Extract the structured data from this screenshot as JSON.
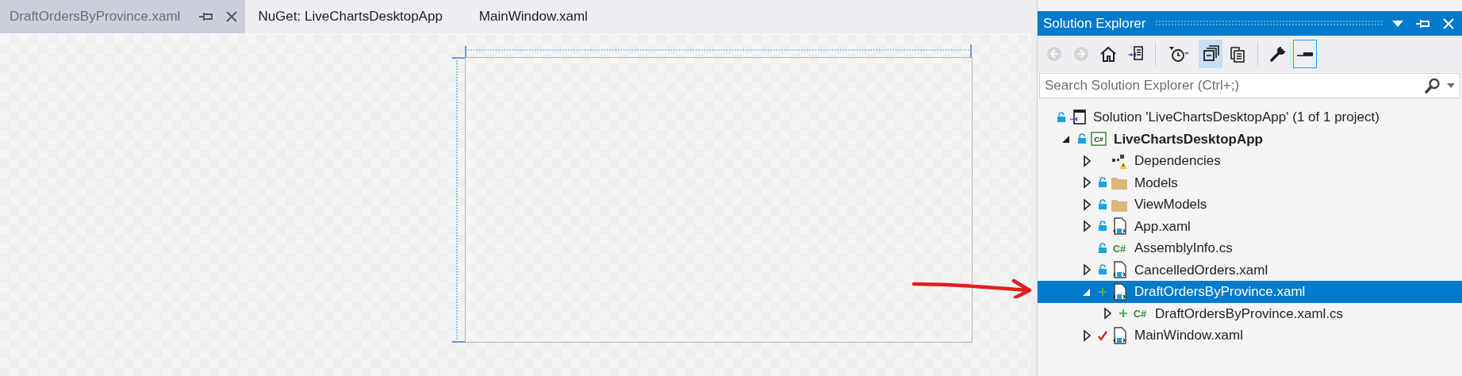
{
  "tabs": [
    {
      "label": "DraftOrdersByProvince.xaml",
      "selected": true
    },
    {
      "label": "NuGet: LiveChartsDesktopApp",
      "selected": false
    },
    {
      "label": "MainWindow.xaml",
      "selected": false
    }
  ],
  "solution_explorer": {
    "title": "Solution Explorer",
    "toolbar": [
      {
        "kind": "back",
        "disabled": true,
        "selected": false
      },
      {
        "kind": "forward",
        "disabled": true,
        "selected": false
      },
      {
        "kind": "home",
        "disabled": false,
        "selected": false
      },
      {
        "kind": "switch-views",
        "disabled": false,
        "selected": false
      },
      {
        "kind": "separator"
      },
      {
        "kind": "pending-filter",
        "disabled": false,
        "selected": false
      },
      {
        "kind": "collapse-all",
        "disabled": false,
        "selected": true
      },
      {
        "kind": "show-all",
        "disabled": false,
        "selected": false
      },
      {
        "kind": "separator"
      },
      {
        "kind": "properties",
        "disabled": false,
        "selected": false
      },
      {
        "kind": "preview",
        "disabled": false,
        "selected": true
      }
    ],
    "search": {
      "placeholder": "Search Solution Explorer (Ctrl+;)"
    },
    "tree": [
      {
        "label": "Solution 'LiveChartsDesktopApp' (1 of 1 project)",
        "kind": "solution",
        "locked": true,
        "added": false,
        "checked_in": false,
        "selected": false,
        "children": [
          {
            "label": "LiveChartsDesktopApp",
            "kind": "project",
            "icon_label": "C#",
            "expanded": true,
            "locked": true,
            "added": false,
            "checked_in": false,
            "selected": false,
            "children": [
              {
                "label": "Dependencies",
                "kind": "dependencies",
                "expanded": false,
                "locked": false,
                "added": false,
                "checked_in": false,
                "selected": false
              },
              {
                "label": "Models",
                "kind": "folder",
                "expanded": false,
                "locked": true,
                "added": false,
                "checked_in": false,
                "selected": false
              },
              {
                "label": "ViewModels",
                "kind": "folder",
                "expanded": false,
                "locked": true,
                "added": false,
                "checked_in": false,
                "selected": false
              },
              {
                "label": "App.xaml",
                "kind": "xaml",
                "expanded": false,
                "locked": true,
                "added": false,
                "checked_in": false,
                "selected": false
              },
              {
                "label": "AssemblyInfo.cs",
                "kind": "cs",
                "icon_label": "C#",
                "locked": true,
                "added": false,
                "checked_in": false,
                "selected": false
              },
              {
                "label": "CancelledOrders.xaml",
                "kind": "xaml",
                "expanded": false,
                "locked": true,
                "added": false,
                "checked_in": false,
                "selected": false
              },
              {
                "label": "DraftOrdersByProvince.xaml",
                "kind": "xaml",
                "expanded": true,
                "locked": false,
                "added": true,
                "checked_in": false,
                "selected": true,
                "children": [
                  {
                    "label": "DraftOrdersByProvince.xaml.cs",
                    "kind": "cs",
                    "icon_label": "C#",
                    "expanded": false,
                    "locked": false,
                    "added": true,
                    "checked_in": false,
                    "selected": false
                  }
                ]
              },
              {
                "label": "MainWindow.xaml",
                "kind": "xaml",
                "expanded": false,
                "locked": false,
                "added": false,
                "checked_in": true,
                "selected": false
              }
            ]
          }
        ]
      }
    ]
  }
}
